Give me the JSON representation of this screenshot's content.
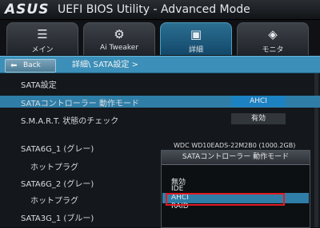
{
  "header": {
    "logo": "ASUS",
    "title": "UEFI BIOS Utility - Advanced Mode"
  },
  "tabs": [
    {
      "label": "メイン",
      "icon": "list-icon",
      "glyph": "☰"
    },
    {
      "label": "Ai Tweaker",
      "icon": "tweaker-icon",
      "glyph": "⚙"
    },
    {
      "label": "詳細",
      "icon": "advanced-icon",
      "glyph": "▣"
    },
    {
      "label": "モニタ",
      "icon": "monitor-icon",
      "glyph": "◈"
    }
  ],
  "nav": {
    "back_label": "Back",
    "back_icon": "back-arrow-icon",
    "breadcrumb": "詳細\\ SATA設定 >"
  },
  "section_title": "SATA設定",
  "settings": [
    {
      "label": "SATAコントローラー 動作モード",
      "value": "AHCI"
    },
    {
      "label": "S.M.A.R.T. 状態のチェック",
      "value": "有効"
    }
  ],
  "ports": [
    {
      "label": "SATA6G_1 (グレー)",
      "device": "WDC WD10EADS-22M2B0 (1000.2GB)"
    },
    {
      "label": "ホットプラグ"
    },
    {
      "label": "SATA6G_2 (グレー)"
    },
    {
      "label": "ホットプラグ"
    },
    {
      "label": "SATA3G_1 (ブルー)"
    }
  ],
  "popup": {
    "title": "SATAコントローラー 動作モード",
    "options": [
      "無効",
      "IDE",
      "AHCI",
      "RAID"
    ],
    "selected": "AHCI"
  },
  "colors": {
    "accent": "#3b8fb8",
    "selected_row": "#2f7ea8",
    "value_box": "#1d82c1",
    "highlight": "#e11b22"
  }
}
